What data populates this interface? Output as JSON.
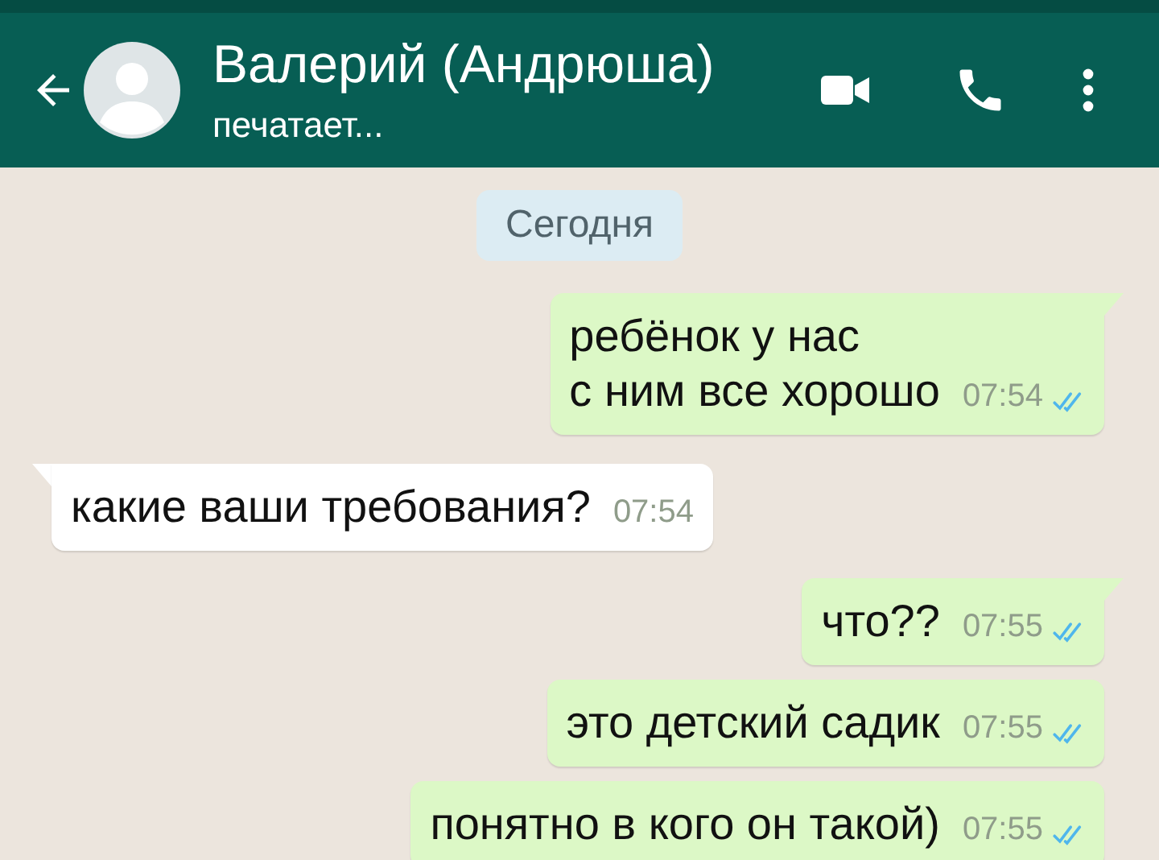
{
  "header": {
    "title": "Валерий (Андрюша)",
    "status": "печатает..."
  },
  "date_chip": "Сегодня",
  "messages": [
    {
      "kind": "outgoing",
      "text": "ребёнок у нас\nс ним все хорошо",
      "time": "07:54",
      "tail": true,
      "read": true
    },
    {
      "kind": "incoming",
      "text": "какие ваши требования?",
      "time": "07:54",
      "tail": true
    },
    {
      "kind": "outgoing",
      "text": "что??",
      "time": "07:55",
      "tail": true,
      "read": true
    },
    {
      "kind": "outgoing",
      "text": "это детский садик",
      "time": "07:55",
      "tail": false,
      "read": true
    },
    {
      "kind": "outgoing",
      "text": "понятно в кого он такой)",
      "time": "07:55",
      "tail": false,
      "read": true
    }
  ]
}
